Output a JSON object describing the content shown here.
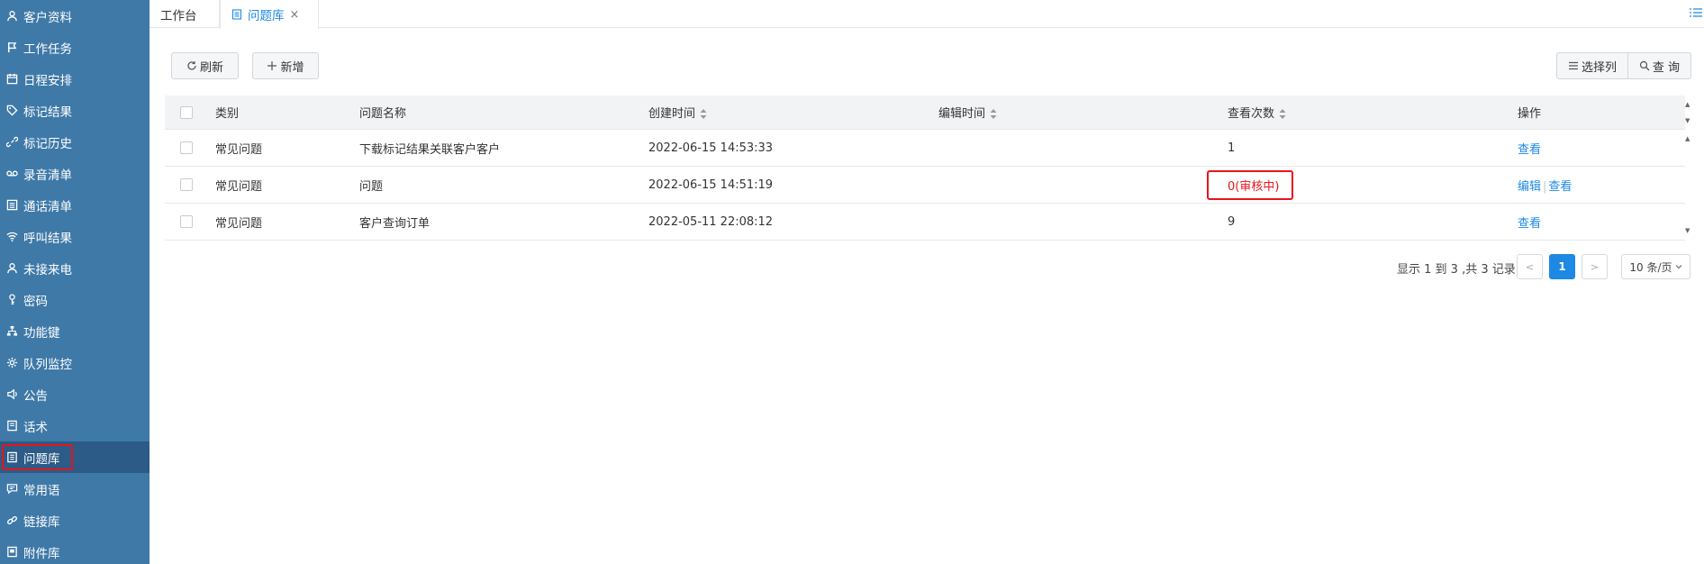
{
  "sidebar": {
    "items": [
      {
        "label": "客户资料",
        "icon": "user-icon"
      },
      {
        "label": "工作任务",
        "icon": "flag-icon"
      },
      {
        "label": "日程安排",
        "icon": "calendar-icon"
      },
      {
        "label": "标记结果",
        "icon": "tag-icon"
      },
      {
        "label": "标记历史",
        "icon": "link-icon"
      },
      {
        "label": "录音清单",
        "icon": "voicemail-icon"
      },
      {
        "label": "通话清单",
        "icon": "list-icon"
      },
      {
        "label": "呼叫结果",
        "icon": "signal-icon"
      },
      {
        "label": "未接来电",
        "icon": "user-icon"
      },
      {
        "label": "密码",
        "icon": "key-icon"
      },
      {
        "label": "功能键",
        "icon": "sitemap-icon"
      },
      {
        "label": "队列监控",
        "icon": "gear-icon"
      },
      {
        "label": "公告",
        "icon": "speaker-icon"
      },
      {
        "label": "话术",
        "icon": "book-icon"
      },
      {
        "label": "问题库",
        "icon": "document-icon"
      },
      {
        "label": "常用语",
        "icon": "comment-icon"
      },
      {
        "label": "链接库",
        "icon": "chain-icon"
      },
      {
        "label": "附件库",
        "icon": "attachment-icon"
      }
    ],
    "active_index": 14
  },
  "tabs": {
    "workbench": "工作台",
    "question_bank": "问题库",
    "close": "×"
  },
  "toolbar": {
    "refresh": "刷新",
    "add": "新增",
    "select_columns": "选择列",
    "query": "查 询"
  },
  "table": {
    "headers": {
      "category": "类别",
      "name": "问题名称",
      "created": "创建时间",
      "edited": "编辑时间",
      "views": "查看次数",
      "actions": "操作"
    },
    "rows": [
      {
        "category": "常见问题",
        "name": "下载标记结果关联客户客户",
        "created": "2022-06-15 14:53:33",
        "edited": "",
        "views": "1",
        "edit": "",
        "view": "查看"
      },
      {
        "category": "常见问题",
        "name": "问题",
        "created": "2022-06-15 14:51:19",
        "edited": "",
        "views": "0(审核中)",
        "edit": "编辑",
        "view": "查看"
      },
      {
        "category": "常见问题",
        "name": "客户查询订单",
        "created": "2022-05-11 22:08:12",
        "edited": "",
        "views": "9",
        "edit": "",
        "view": "查看"
      }
    ]
  },
  "pagination": {
    "info": "显示 1 到 3 ,共 3 记录",
    "prev": "<",
    "current": "1",
    "next": ">",
    "page_size": "10 条/页"
  },
  "colors": {
    "sidebar_bg": "#3f79a8",
    "sidebar_active": "#2b5b86",
    "accent": "#1e88e5",
    "highlight": "#e8141b"
  }
}
